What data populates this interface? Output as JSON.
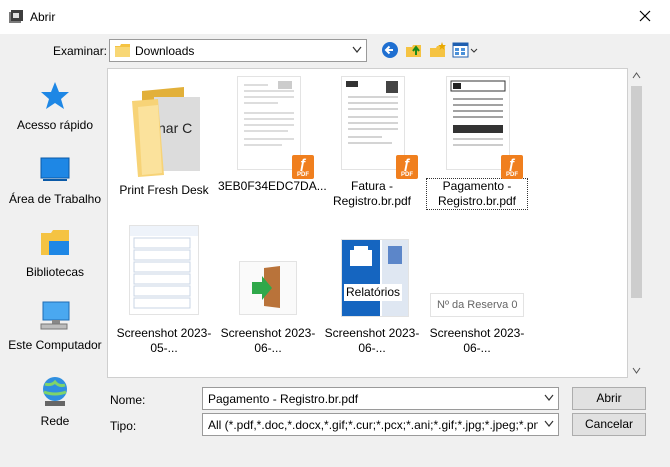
{
  "window": {
    "title": "Abrir"
  },
  "toolbar": {
    "look_in_label": "Examinar:",
    "look_in_value": "Downloads"
  },
  "places": [
    {
      "label": "Acesso rápido",
      "icon": "star-icon"
    },
    {
      "label": "Área de Trabalho",
      "icon": "desktop-icon"
    },
    {
      "label": "Bibliotecas",
      "icon": "libraries-icon"
    },
    {
      "label": "Este Computador",
      "icon": "computer-icon"
    },
    {
      "label": "Rede",
      "icon": "network-icon"
    }
  ],
  "files": [
    {
      "label": "Print Fresh Desk",
      "type": "folder"
    },
    {
      "label": "3EB0F34EDC7DA...",
      "type": "pdf"
    },
    {
      "label": "Fatura - Registro.br.pdf",
      "type": "pdf"
    },
    {
      "label": "Pagamento - Registro.br.pdf",
      "type": "pdf",
      "selected": true
    },
    {
      "label": "Screenshot 2023-05-...",
      "type": "image"
    },
    {
      "label": "Screenshot 2023-06-...",
      "type": "image"
    },
    {
      "label": "Screenshot 2023-06-...",
      "type": "image",
      "overlay_text": "Relatórios"
    },
    {
      "label": "Screenshot 2023-06-...",
      "type": "image",
      "overlay_text": "Nº da Reserva 0"
    }
  ],
  "footer": {
    "name_label": "Nome:",
    "name_value": "Pagamento - Registro.br.pdf",
    "type_label": "Tipo:",
    "type_value": "All (*.pdf,*.doc,*.docx,*.gif;*.cur;*.pcx;*.ani;*.gif;*.jpg;*.jpeg;*.png;*.bmp;",
    "open_button": "Abrir",
    "cancel_button": "Cancelar"
  },
  "colors": {
    "accent": "#0078d7",
    "pdf_badge": "#f07f1e",
    "folder": "#f5c342"
  }
}
